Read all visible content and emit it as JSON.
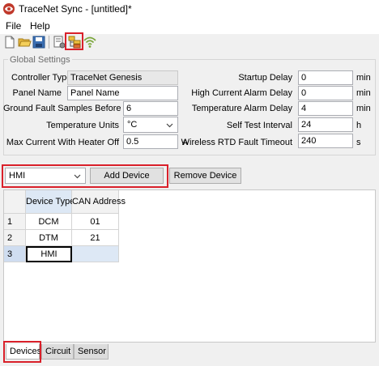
{
  "window": {
    "title": "TraceNet Sync - [untitled]*"
  },
  "menu": {
    "items": [
      "File",
      "Help"
    ]
  },
  "toolbar": {
    "icons": [
      "new-file-icon",
      "open-folder-icon",
      "save-icon",
      "settings-list-icon",
      "device-tree-icon",
      "wireless-icon"
    ],
    "highlighted": "device-tree-icon"
  },
  "global_settings": {
    "title": "Global Settings",
    "controller_type": {
      "label": "Controller Type",
      "value": "TraceNet Genesis"
    },
    "panel_name": {
      "label": "Panel Name",
      "value": "Panel Name"
    },
    "ground_fault_samples": {
      "label": "Ground Fault Samples Before Trip",
      "value": "6"
    },
    "temperature_units": {
      "label": "Temperature Units",
      "value": "°C"
    },
    "max_current_heater_off": {
      "label": "Max Current With Heater Off",
      "value": "0.5",
      "unit": "A"
    },
    "startup_delay": {
      "label": "Startup Delay",
      "value": "0",
      "unit": "min"
    },
    "high_current_alarm_delay": {
      "label": "High Current Alarm Delay",
      "value": "0",
      "unit": "min"
    },
    "temperature_alarm_delay": {
      "label": "Temperature Alarm Delay",
      "value": "4",
      "unit": "min"
    },
    "self_test_interval": {
      "label": "Self Test Interval",
      "value": "24",
      "unit": "h"
    },
    "wireless_rtd_timeout": {
      "label": "Wireless RTD Fault Timeout",
      "value": "240",
      "unit": "s"
    }
  },
  "device_controls": {
    "device_type_value": "HMI",
    "add_label": "Add Device",
    "remove_label": "Remove Device"
  },
  "devices_table": {
    "columns": [
      "Device Type",
      "CAN Address"
    ],
    "rows": [
      {
        "index": "1",
        "device_type": "DCM",
        "can_address": "01"
      },
      {
        "index": "2",
        "device_type": "DTM",
        "can_address": "21"
      },
      {
        "index": "3",
        "device_type": "HMI",
        "can_address": ""
      }
    ],
    "selected_row": "3"
  },
  "tabs": [
    "Devices",
    "Circuit",
    "Sensor"
  ],
  "active_tab": "Devices",
  "colors": {
    "highlight": "#d9202a",
    "selection": "#dde8f5"
  }
}
